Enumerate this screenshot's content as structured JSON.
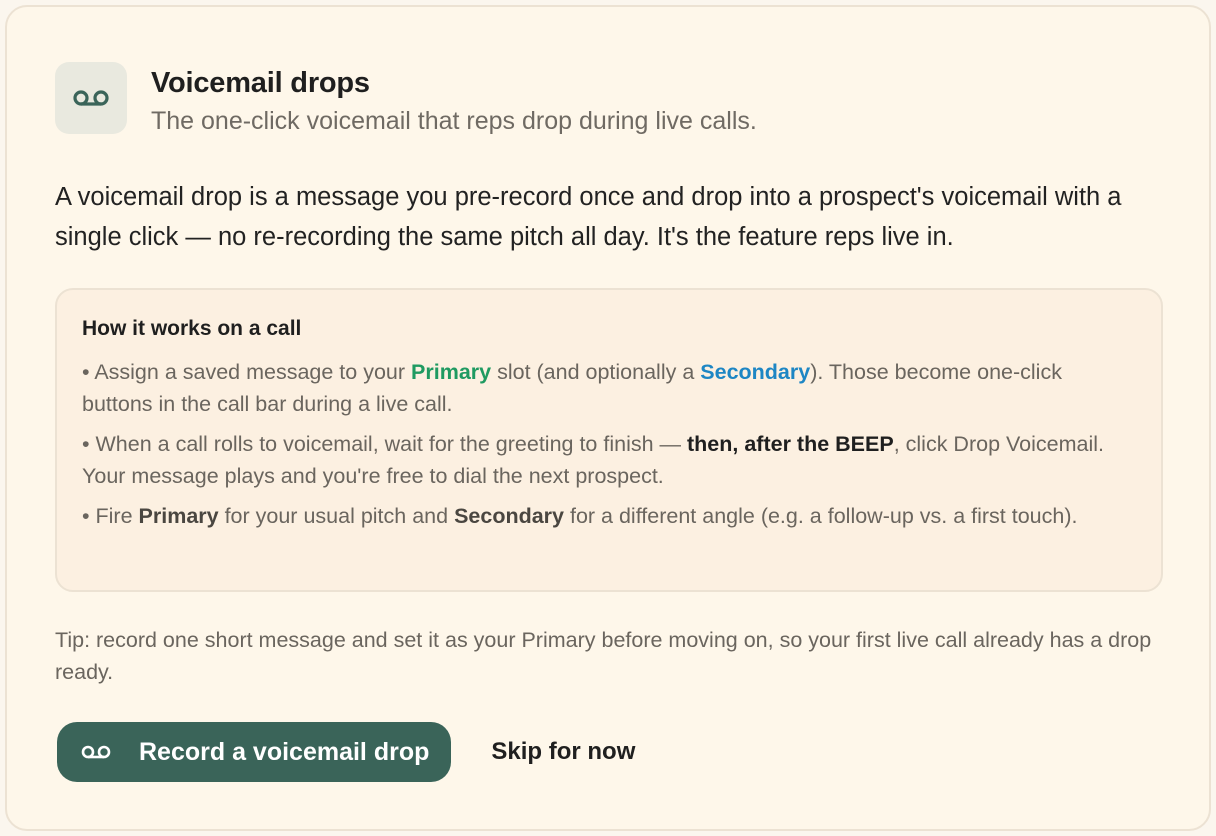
{
  "colors": {
    "accent": "#3a6459",
    "primary_highlight": "#1f9a61",
    "secondary_highlight": "#1d86c4",
    "card_background": "#fef7ea",
    "panel_background": "#fcf0e1"
  },
  "header": {
    "icon": "voicemail-icon",
    "title": "Voicemail drops",
    "subtitle": "The one-click voicemail that reps drop during live calls."
  },
  "intro": "A voicemail drop is a message you pre-record once and drop into a prospect's voicemail with a single click — no re-recording the same pitch all day. It's the feature reps live in.",
  "how_it_works": {
    "title": "How it works on a call",
    "bullet1": {
      "pre": "• Assign a saved message to your ",
      "primary": "Primary",
      "mid": " slot (and optionally a ",
      "secondary": "Secondary",
      "post": "). Those become one-click buttons in the call bar during a live call."
    },
    "bullet2": {
      "pre": "• When a call rolls to voicemail, wait for the greeting to finish — ",
      "emphasis": "then, after the BEEP",
      "post": ", click Drop Voicemail. Your message plays and you're free to dial the next prospect."
    },
    "bullet3": {
      "pre": "• Fire ",
      "primary": "Primary",
      "mid": " for your usual pitch and ",
      "secondary": "Secondary",
      "post": " for a different angle (e.g. a follow-up vs. a first touch)."
    }
  },
  "tip": "Tip: record one short message and set it as your Primary before moving on, so your first live call already has a drop ready.",
  "actions": {
    "record_icon": "voicemail-icon",
    "record_label": "Record a voicemail drop",
    "skip_label": "Skip for now"
  }
}
